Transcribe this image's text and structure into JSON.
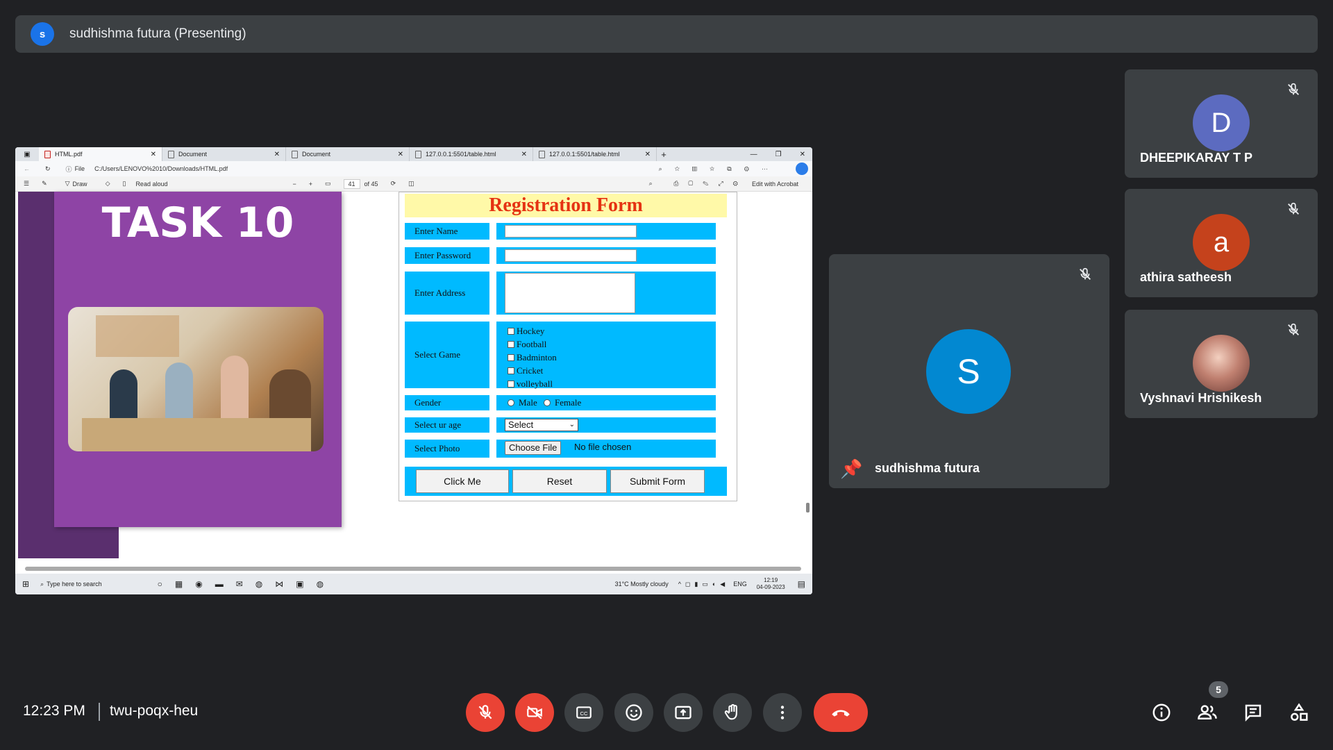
{
  "presenting": {
    "initial": "s",
    "text": "sudhishma futura (Presenting)"
  },
  "browser": {
    "tabs": [
      "HTML.pdf",
      "Document",
      "Document",
      "127.0.0.1:5501/table.html",
      "127.0.0.1:5501/table.html"
    ],
    "file_label": "File",
    "address": "C:/Users/LENOVO%2010/Downloads/HTML.pdf",
    "draw_label": "Draw",
    "read_aloud_label": "Read aloud",
    "page_number": "41",
    "page_total": "of 45",
    "edit_acrobat_label": "Edit with Acrobat"
  },
  "pdf": {
    "task_title": "TASK 10",
    "form": {
      "title": "Registration Form",
      "labels": {
        "name": "Enter Name",
        "password": "Enter Password",
        "address": "Enter Address",
        "game": "Select Game",
        "gender": "Gender",
        "age": "Select ur age",
        "photo": "Select Photo"
      },
      "games": [
        "Hockey",
        "Football",
        "Badminton",
        "Cricket",
        "volleyball"
      ],
      "genders": [
        "Male",
        "Female"
      ],
      "age_select": "Select",
      "choose_file": "Choose File",
      "no_file": "No file chosen",
      "buttons": [
        "Click Me",
        "Reset",
        "Submit Form"
      ]
    }
  },
  "taskbar": {
    "search_placeholder": "Type here to search",
    "weather": "31°C  Mostly cloudy",
    "lang": "ENG",
    "time": "12:19",
    "date": "04-09-2023"
  },
  "participants": [
    {
      "initial": "D",
      "name": "DHEEPIKARAY T P",
      "color": "#5c6bc0"
    },
    {
      "initial": "a",
      "name": "athira satheesh",
      "color": "#c5421c"
    },
    {
      "initial": "",
      "name": "Vyshnavi Hrishikesh",
      "color": "#b07a6a"
    }
  ],
  "main_tile": {
    "initial": "S",
    "name": "sudhishma futura",
    "color": "#0288d1"
  },
  "meeting": {
    "time": "12:23 PM",
    "code": "twu-poqx-heu",
    "people_count": "5"
  }
}
